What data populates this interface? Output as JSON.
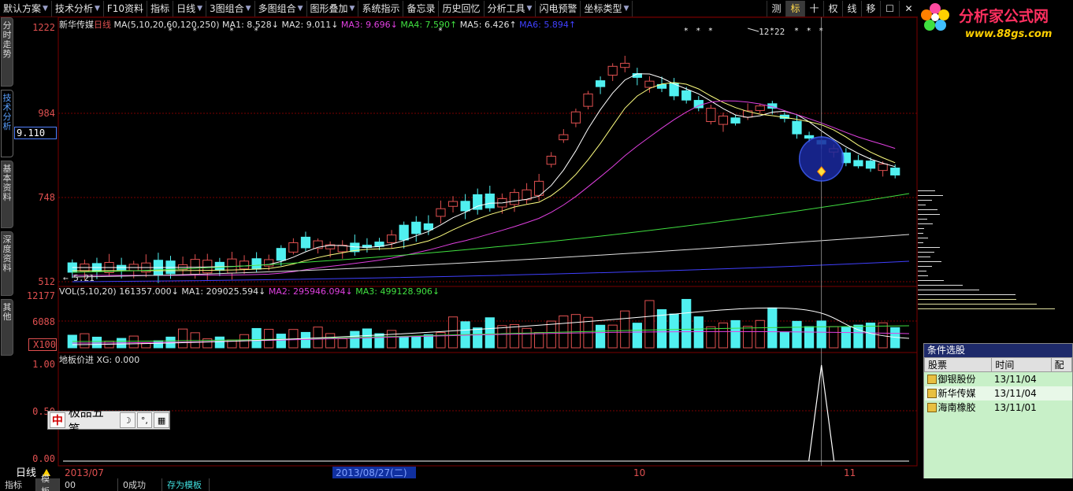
{
  "toolbar": {
    "items": [
      {
        "label": "默认方案",
        "caret": true
      },
      {
        "label": "技术分析",
        "caret": true
      },
      {
        "label": "F10资料",
        "caret": false
      },
      {
        "label": "指标",
        "caret": false
      },
      {
        "label": "日线",
        "caret": true
      },
      {
        "label": "3图组合",
        "caret": true
      },
      {
        "label": "多图组合",
        "caret": true
      },
      {
        "label": "图形叠加",
        "caret": true
      },
      {
        "label": "系统指示",
        "caret": false
      },
      {
        "label": "备忘录",
        "caret": false
      },
      {
        "label": "历史回忆",
        "caret": false
      },
      {
        "label": "分析工具",
        "caret": true
      },
      {
        "label": "闪电预警",
        "caret": false
      },
      {
        "label": "坐标类型",
        "caret": true
      }
    ],
    "right_buttons": [
      "测",
      "标",
      "十",
      "权",
      "线",
      "移",
      "☐",
      "✕"
    ],
    "active_right": "标"
  },
  "logo": {
    "title": "分析家公式网",
    "url_text": "www.88gs.com"
  },
  "left_tabs": [
    "分时走势",
    "技术分析",
    "基本资料",
    "深度资料",
    "其他"
  ],
  "active_left_tab": "技术分析",
  "price_panel": {
    "stock_name": "新华传媒",
    "period": "日线",
    "ma_line": [
      {
        "text": "MA(5,10,20,60,120,250)",
        "color": "#e0e0e0"
      },
      {
        "text": "MA1: 8.528↓",
        "color": "#e0e0e0"
      },
      {
        "text": "MA2: 9.011↓",
        "color": "#e0e0e0"
      },
      {
        "text": "MA3: 9.696↓",
        "color": "#e040e0"
      },
      {
        "text": "MA4: 7.590↑",
        "color": "#40e040"
      },
      {
        "text": "MA5: 6.426↑",
        "color": "#e0e0e0"
      },
      {
        "text": "MA6: 5.894↑",
        "color": "#4040ff"
      }
    ],
    "y_labels": [
      "1222",
      "984",
      "748",
      "512"
    ],
    "current_price": "9.110",
    "high_label": "12.22",
    "low_label": "5.21"
  },
  "volume_panel": {
    "header": [
      {
        "text": "VOL(5,10,20)",
        "color": "#e0e0e0"
      },
      {
        "text": "161357.000↓",
        "color": "#e0e0e0"
      },
      {
        "text": "MA1: 209025.594↓",
        "color": "#e0e0e0"
      },
      {
        "text": "MA2: 295946.094↓",
        "color": "#e040e0"
      },
      {
        "text": "MA3: 499128.906↓",
        "color": "#40e040"
      }
    ],
    "y_labels": [
      "12177",
      "6088"
    ],
    "multiplier": "X100"
  },
  "indicator_panel": {
    "header": "地板价进 XG: 0.000",
    "y_labels": [
      "1.00",
      "0.50",
      "0.00"
    ]
  },
  "date_axis": {
    "labels": [
      "2013/07",
      "2013/08/27(二)",
      "10",
      "11"
    ],
    "period_label": "日线"
  },
  "bottom_bar": [
    "指标",
    "模板",
    "00",
    "0成功",
    "存为模板"
  ],
  "ime": {
    "logo": "中",
    "name": "极品五笔"
  },
  "selection_panel": {
    "title": "条件选股",
    "columns": [
      "股票",
      "时间",
      "配"
    ],
    "rows": [
      {
        "name": "御银股份",
        "time": "13/11/04"
      },
      {
        "name": "新华传媒",
        "time": "13/11/04"
      },
      {
        "name": "海南橡胶",
        "time": "13/11/01"
      }
    ]
  },
  "colors": {
    "up": "#e05050",
    "down": "#50f0f0",
    "grid": "#7a0000",
    "ma1": "#ffffff",
    "ma2": "#ffff80",
    "ma3": "#e040e0",
    "ma4": "#40e040",
    "ma5": "#e0e0e0",
    "ma6": "#4040ff"
  }
}
